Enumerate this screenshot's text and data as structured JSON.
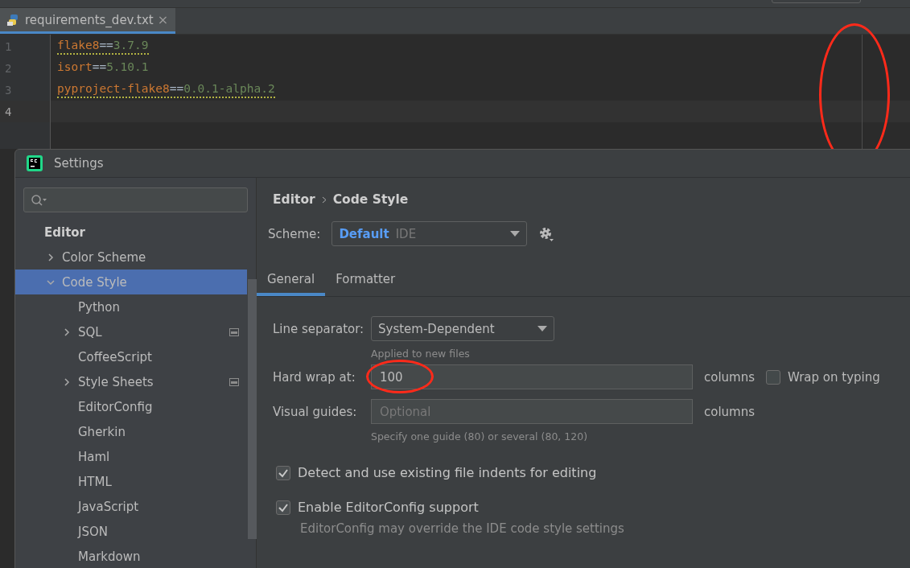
{
  "editor": {
    "tab": {
      "label": "requirements_dev.txt",
      "close": "×",
      "selected": true
    },
    "lines": [
      {
        "number": "1",
        "current": false,
        "warning": true,
        "tokens": [
          {
            "kind": "name",
            "text": "flake8"
          },
          {
            "kind": "op",
            "text": "=="
          },
          {
            "kind": "version",
            "text": "3.7.9"
          }
        ]
      },
      {
        "number": "2",
        "current": false,
        "warning": false,
        "tokens": [
          {
            "kind": "name",
            "text": "isort"
          },
          {
            "kind": "op",
            "text": "=="
          },
          {
            "kind": "version",
            "text": "5.10.1"
          }
        ]
      },
      {
        "number": "3",
        "current": false,
        "warning": true,
        "tokens": [
          {
            "kind": "name",
            "text": "pyproject-flake8"
          },
          {
            "kind": "op",
            "text": "=="
          },
          {
            "kind": "version",
            "text": "0.0.1-alpha.2"
          }
        ]
      },
      {
        "number": "4",
        "current": true
      }
    ],
    "guide": {
      "circled": true
    }
  },
  "settings": {
    "title": "Settings",
    "tree": {
      "header": "Editor",
      "items": [
        {
          "label": "Color Scheme",
          "expanded": false,
          "has_children": true,
          "selected": false,
          "scheme_icon": false
        },
        {
          "label": "Code Style",
          "expanded": true,
          "has_children": true,
          "selected": true,
          "scheme_icon": false,
          "children": [
            {
              "label": "Python",
              "has_children": false,
              "selected": false,
              "scheme_icon": false
            },
            {
              "label": "SQL",
              "has_children": true,
              "expanded": false,
              "selected": false,
              "scheme_icon": true
            },
            {
              "label": "CoffeeScript",
              "has_children": false,
              "selected": false,
              "scheme_icon": false
            },
            {
              "label": "Style Sheets",
              "has_children": true,
              "expanded": false,
              "selected": false,
              "scheme_icon": true
            },
            {
              "label": "EditorConfig",
              "has_children": false,
              "selected": false,
              "scheme_icon": false
            },
            {
              "label": "Gherkin",
              "has_children": false,
              "selected": false,
              "scheme_icon": false
            },
            {
              "label": "Haml",
              "has_children": false,
              "selected": false,
              "scheme_icon": false
            },
            {
              "label": "HTML",
              "has_children": false,
              "selected": false,
              "scheme_icon": false
            },
            {
              "label": "JavaScript",
              "has_children": false,
              "selected": false,
              "scheme_icon": false
            },
            {
              "label": "JSON",
              "has_children": false,
              "selected": false,
              "scheme_icon": false
            },
            {
              "label": "Markdown",
              "has_children": false,
              "selected": false,
              "scheme_icon": false
            }
          ]
        }
      ]
    },
    "breadcrumb": [
      "Editor",
      "Code Style"
    ],
    "scheme": {
      "label": "Scheme:",
      "name": "Default",
      "level": "IDE"
    },
    "tabs": [
      {
        "label": "General",
        "selected": true
      },
      {
        "label": "Formatter",
        "selected": false
      }
    ],
    "line_separator": {
      "label": "Line separator:",
      "value": "System-Dependent",
      "hint": "Applied to new files"
    },
    "hard_wrap": {
      "label": "Hard wrap at:",
      "value": "100",
      "unit": "columns",
      "circled": true,
      "wrap_on_typing": {
        "label": "Wrap on typing",
        "checked": false
      }
    },
    "visual_guides": {
      "label": "Visual guides:",
      "placeholder": "Optional",
      "unit": "columns",
      "hint": "Specify one guide (80) or several (80, 120)"
    },
    "options": [
      {
        "label": "Detect and use existing file indents for editing",
        "checked": true
      },
      {
        "label": "Enable EditorConfig support",
        "checked": true,
        "note": "EditorConfig may override the IDE code style settings"
      }
    ]
  }
}
